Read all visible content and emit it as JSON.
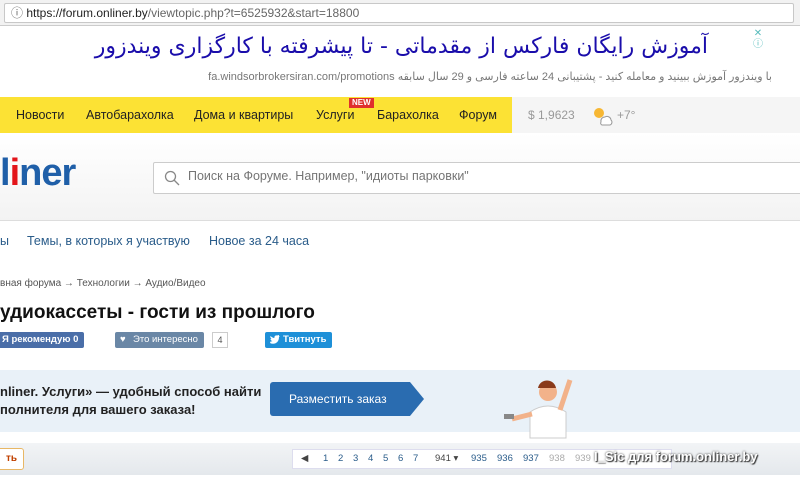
{
  "browser": {
    "url_host": "https://forum.onliner.by",
    "url_path": "/viewtopic.php?t=6525932&start=18800"
  },
  "ad": {
    "title": "آموزش رایگان فارکس از مقدماتی - تا پیشرفته با کارگزاری ویندزور",
    "subtitle": "با ویندزور آموزش ببینید و معامله کنید - پشتیبانی 24 ساعته فارسی و 29 سال سابقه fa.windsorbrokersiran.com/promotions"
  },
  "nav": {
    "items": [
      "Новости",
      "Автобарахолка",
      "Дома и квартиры",
      "Услуги",
      "Барахолка",
      "Форум"
    ],
    "new_badge": "NEW",
    "rate": "$ 1,9623",
    "temp": "+7°"
  },
  "logo": {
    "a": "l",
    "b": "i",
    "c": "ner"
  },
  "search": {
    "placeholder": "Поиск на Форуме. Например, \"идиоты парковки\""
  },
  "subnav": [
    "ы",
    "Темы, в которых я участвую",
    "Новое за 24 часа"
  ],
  "breadcrumb": "вная форума  →  Технологии  →  Аудио/Видео",
  "topic": {
    "title": "удиокассеты - гости из прошлого"
  },
  "social": {
    "recommend": "Я рекомендую 0",
    "interesting": "Это интересно",
    "interesting_count": "4",
    "tweet": "Твитнуть"
  },
  "banner": {
    "line1": "nliner. Услуги» — удобный способ найти",
    "line2": "полнителя для вашего заказа!",
    "button": "Разместить заказ"
  },
  "toolbar": {
    "reply": "ть"
  },
  "pager": {
    "pages": [
      "1",
      "2",
      "3",
      "4",
      "5",
      "6",
      "7"
    ],
    "current_select": "941 ▾",
    "recent": [
      "935",
      "936",
      "937",
      "938",
      "939"
    ]
  },
  "watermark": "I_Sic для forum.onliner.by",
  "colors": {
    "nav": "#fce234",
    "link": "#2a5c8a",
    "brand_blue": "#1f5fa8",
    "brand_red": "#e3151a"
  }
}
